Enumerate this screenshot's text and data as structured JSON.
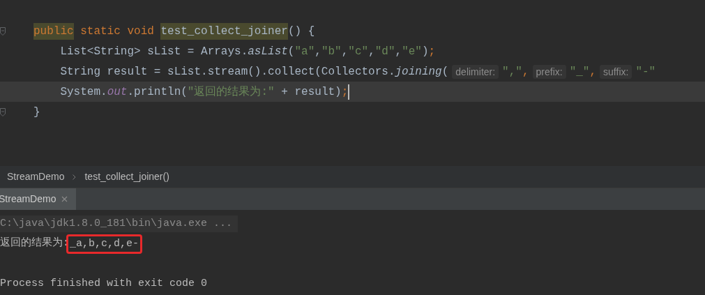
{
  "editor": {
    "lines": [
      {
        "fold": true,
        "current": false,
        "tokens": [
          {
            "kind": "keyword",
            "text": "public",
            "highlighted": true
          },
          {
            "kind": "keyword",
            "text": " static void ",
            "highlighted": false
          },
          {
            "kind": "plain",
            "text": "test_collect_joiner",
            "highlighted": true
          },
          {
            "kind": "plain",
            "text": "() {",
            "highlighted": false
          }
        ]
      },
      {
        "fold": false,
        "current": false,
        "tokens": [
          {
            "kind": "plain",
            "text": "    List<String> sList = Arrays.",
            "highlighted": false
          },
          {
            "kind": "static",
            "text": "asList",
            "highlighted": false
          },
          {
            "kind": "plain",
            "text": "(",
            "highlighted": false
          },
          {
            "kind": "string",
            "text": "\"a\"",
            "highlighted": false
          },
          {
            "kind": "plain",
            "text": ",",
            "highlighted": false
          },
          {
            "kind": "string",
            "text": "\"b\"",
            "highlighted": false
          },
          {
            "kind": "plain",
            "text": ",",
            "highlighted": false
          },
          {
            "kind": "string",
            "text": "\"c\"",
            "highlighted": false
          },
          {
            "kind": "plain",
            "text": ",",
            "highlighted": false
          },
          {
            "kind": "string",
            "text": "\"d\"",
            "highlighted": false
          },
          {
            "kind": "plain",
            "text": ",",
            "highlighted": false
          },
          {
            "kind": "string",
            "text": "\"e\"",
            "highlighted": false
          },
          {
            "kind": "plain",
            "text": ")",
            "highlighted": false
          },
          {
            "kind": "keyword",
            "text": ";",
            "highlighted": false
          }
        ]
      },
      {
        "fold": false,
        "current": false,
        "tokens": [
          {
            "kind": "plain",
            "text": "    String result = sList.stream().collect(Collectors."
          },
          {
            "kind": "static",
            "text": "joining"
          },
          {
            "kind": "plain",
            "text": "("
          },
          {
            "kind": "hint",
            "text": "delimiter:"
          },
          {
            "kind": "string",
            "text": "\",\""
          },
          {
            "kind": "keyword",
            "text": ","
          },
          {
            "kind": "hint",
            "text": "prefix:"
          },
          {
            "kind": "string",
            "text": "\"_\""
          },
          {
            "kind": "keyword",
            "text": ","
          },
          {
            "kind": "hint",
            "text": "suffix:"
          },
          {
            "kind": "string",
            "text": "\"-\""
          }
        ]
      },
      {
        "fold": false,
        "current": true,
        "tokens": [
          {
            "kind": "plain",
            "text": "    System."
          },
          {
            "kind": "field",
            "text": "out"
          },
          {
            "kind": "plain",
            "text": ".println("
          },
          {
            "kind": "string",
            "text": "\"返回的结果为:\""
          },
          {
            "kind": "plain",
            "text": " + result)"
          },
          {
            "kind": "keyword",
            "text": ";"
          }
        ]
      },
      {
        "fold": true,
        "current": false,
        "tokens": [
          {
            "kind": "plain",
            "text": "}"
          }
        ]
      }
    ]
  },
  "breadcrumbs": [
    "StreamDemo",
    "test_collect_joiner()"
  ],
  "run_tabs": [
    {
      "label": "StreamDemo",
      "selected": true
    }
  ],
  "console": {
    "lines": [
      {
        "kind": "command",
        "text": "C:\\java\\jdk1.8.0_181\\bin\\java.exe ..."
      },
      {
        "kind": "output",
        "text": "返回的结果为:",
        "boxed": "_a,b,c,d,e-"
      },
      {
        "kind": "exit",
        "text": "Process finished with exit code 0"
      }
    ]
  }
}
